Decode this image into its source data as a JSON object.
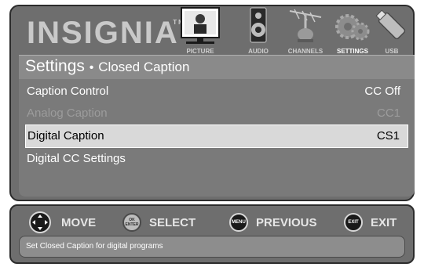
{
  "brand": {
    "name": "INSIGNIA",
    "tm": "TM"
  },
  "tabs": [
    {
      "label": "PICTURE",
      "icon": "tv-icon"
    },
    {
      "label": "AUDIO",
      "icon": "speaker-icon"
    },
    {
      "label": "CHANNELS",
      "icon": "antenna-icon"
    },
    {
      "label": "SETTINGS",
      "icon": "gears-icon"
    },
    {
      "label": "USB",
      "icon": "usb-drive-icon"
    }
  ],
  "header": {
    "title": "Settings",
    "separator": "•",
    "subtitle": "Closed Caption"
  },
  "rows": [
    {
      "label": "Caption Control",
      "value": "CC Off"
    },
    {
      "label": "Analog Caption",
      "value": "CC1"
    },
    {
      "label": "Digital Caption",
      "value": "CS1"
    },
    {
      "label": "Digital CC Settings",
      "value": ""
    }
  ],
  "nav": {
    "move": {
      "label": "MOVE",
      "icon": "dpad-icon"
    },
    "select": {
      "label": "SELECT",
      "icon_text": "OK ENTER",
      "icon": "ok-enter-icon"
    },
    "previous": {
      "label": "PREVIOUS",
      "icon_text": "MENU",
      "icon": "menu-icon"
    },
    "exit": {
      "label": "EXIT",
      "icon_text": "EXIT",
      "icon": "exit-icon"
    }
  },
  "hint": "Set Closed Caption for digital programs"
}
